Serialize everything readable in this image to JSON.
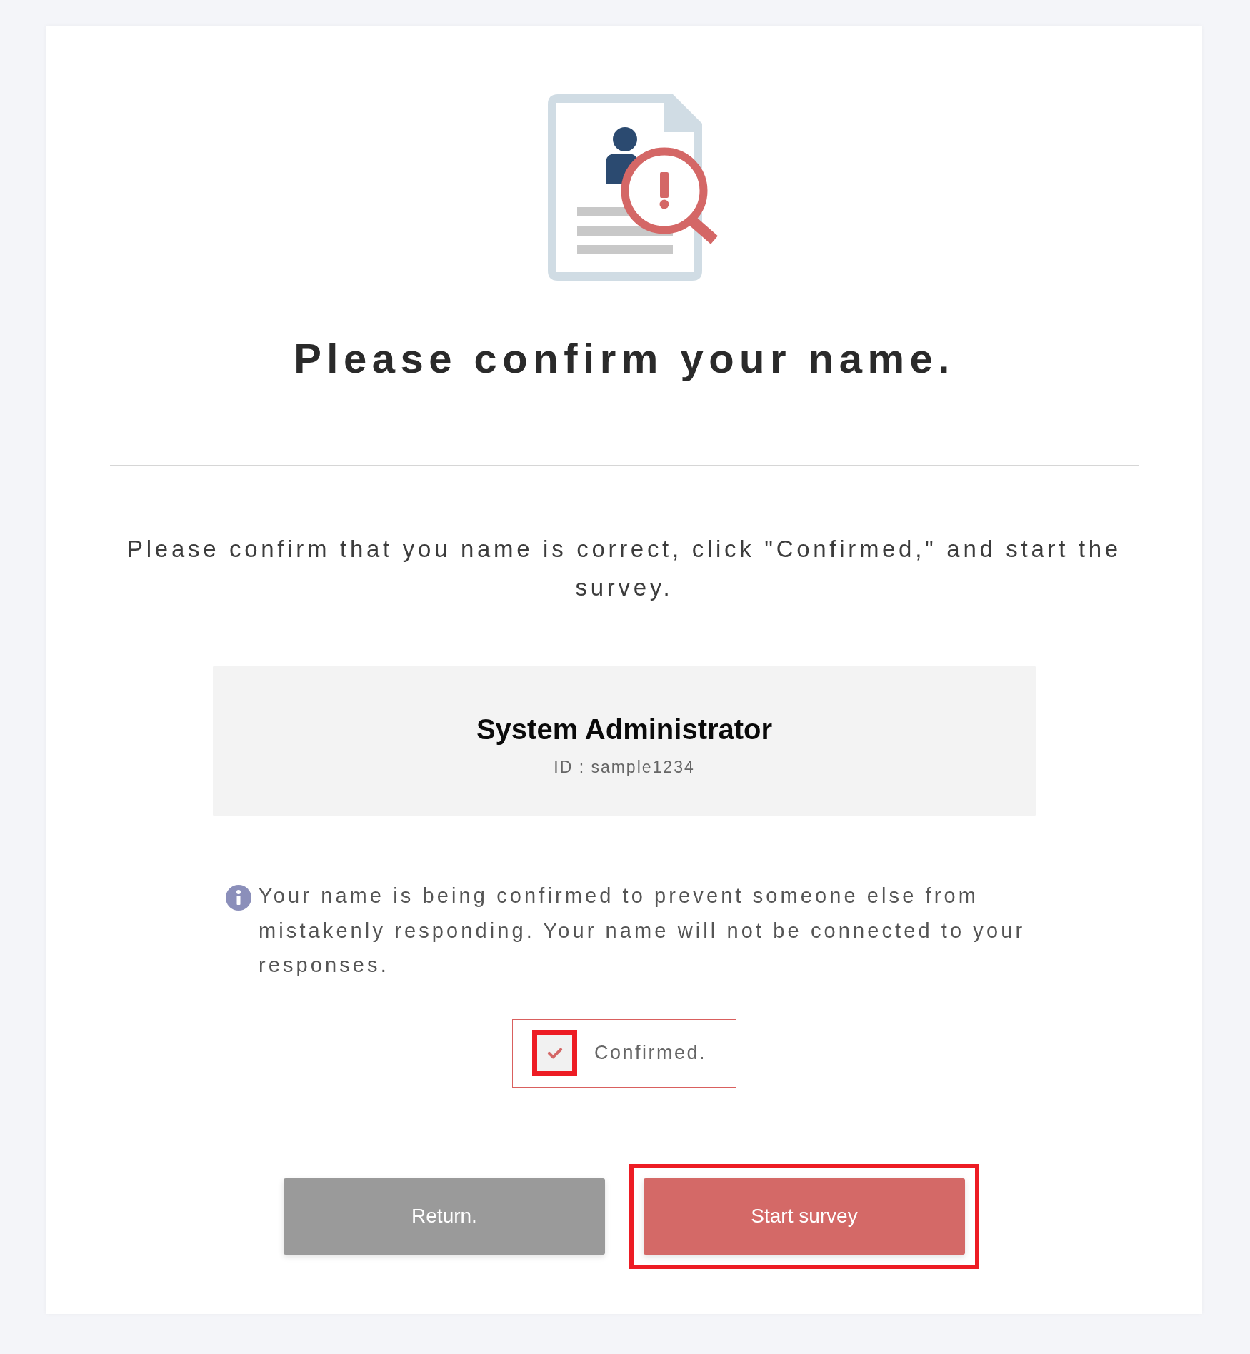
{
  "title": "Please confirm your name.",
  "instructions": "Please confirm that you name is correct, click \"Confirmed,\" and start the survey.",
  "user": {
    "name": "System Administrator",
    "id": "ID : sample1234"
  },
  "notice": "Your name is being confirmed to prevent someone else from mistakenly responding. Your name will not be connected to your responses.",
  "confirmation": {
    "label": "Confirmed.",
    "checked": true,
    "highlighted": true
  },
  "buttons": [
    {
      "label": "Return.",
      "kind": "secondary",
      "highlighted": false
    },
    {
      "label": "Start survey",
      "kind": "primary",
      "highlighted": true
    }
  ]
}
